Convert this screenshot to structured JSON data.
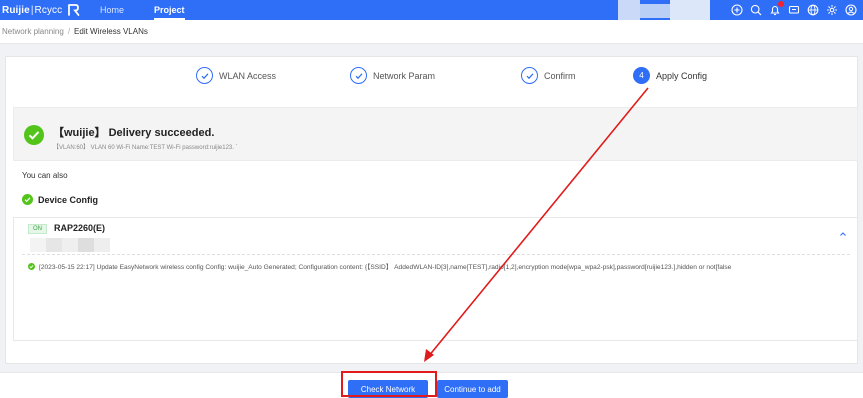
{
  "header": {
    "brand_primary": "Ruijie",
    "brand_separator": "|",
    "brand_secondary": "Rcycc",
    "nav": [
      {
        "label": "Home"
      },
      {
        "label": "Project"
      }
    ],
    "accent_color": "#2f6ef7",
    "icons": [
      "plus-circle-icon",
      "search-icon",
      "bell-icon",
      "message-icon",
      "globe-icon",
      "settings-icon",
      "user-icon"
    ]
  },
  "breadcrumb": {
    "parent": "Network planning",
    "separator": "/",
    "current": "Edit Wireless VLANs"
  },
  "steps": [
    {
      "label": "WLAN Access",
      "state": "done"
    },
    {
      "label": "Network Param",
      "state": "done"
    },
    {
      "label": "Confirm",
      "state": "done"
    },
    {
      "label": "Apply Config",
      "state": "active",
      "number": "4"
    }
  ],
  "result": {
    "title": "【wuijie】 Delivery succeeded.",
    "detail": "【VLAN:60】 VLAN 60  Wi-Fi Name:TEST  Wi-Fi password:ruijie123.  `"
  },
  "section": {
    "you_can_also": "You can also",
    "device_config": "Device Config"
  },
  "device": {
    "status": "ON",
    "name": "RAP2260(E)",
    "log": "[2023-05-15 22:17]  Update EasyNetwork wireless config Config: wuijie_Auto Generated; Configuration content: {【SSID】 AddedWLAN-ID[3],name[TEST],radio[1,2],encryption mode[wpa_wpa2-psk],password[ruijie123.],hidden or not[false"
  },
  "footer": {
    "check_network": "Check Network",
    "continue_to_add": "Continue to add"
  }
}
